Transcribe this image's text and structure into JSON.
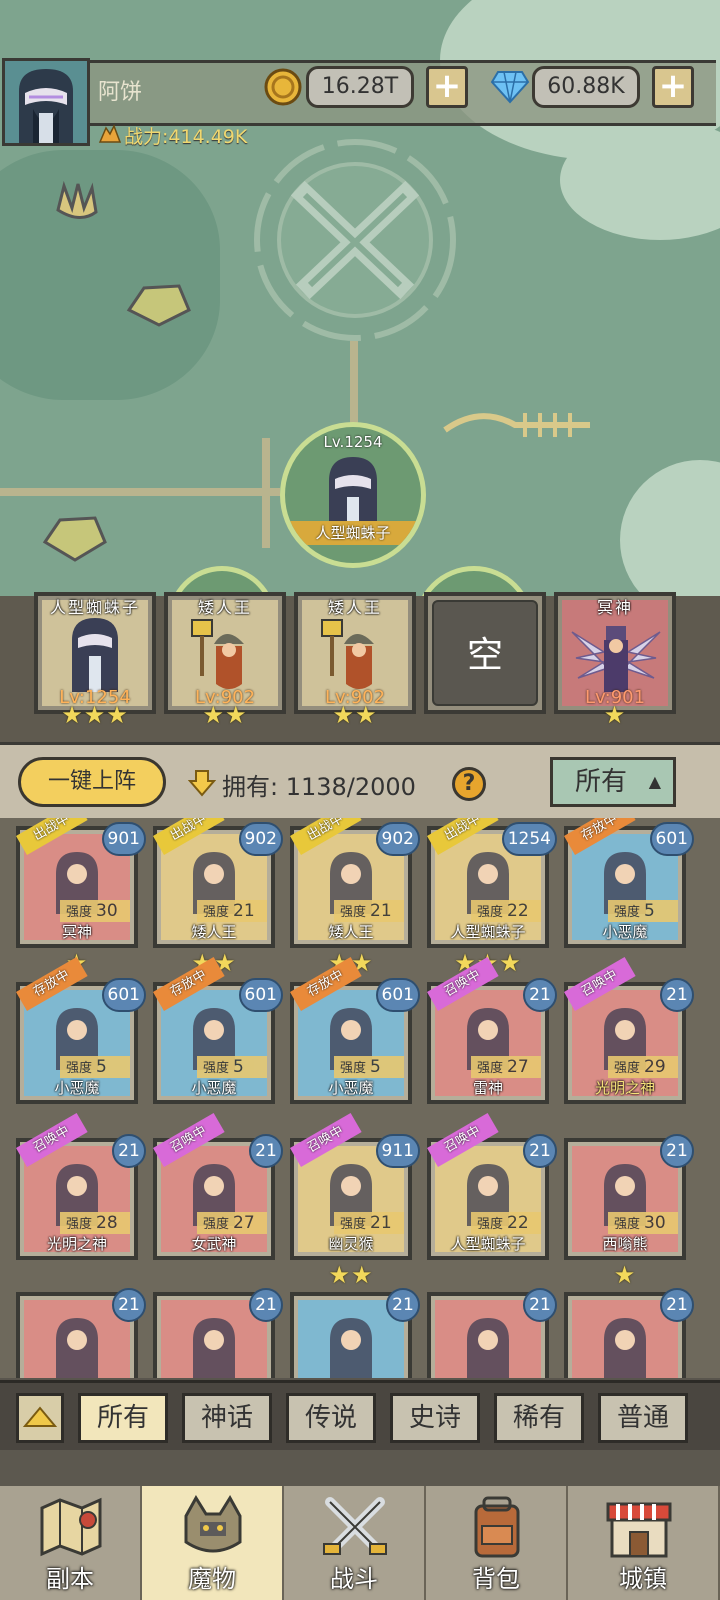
{
  "header": {
    "player_name": "阿饼",
    "power": "战力:414.49K",
    "gold": "16.28T",
    "gems": "60.88K",
    "plus": "+"
  },
  "bubble": {
    "level": "Lv.1254",
    "name": "人型蜘蛛子"
  },
  "team": [
    {
      "name": "人型蜘蛛子",
      "level": "Lv:1254",
      "stars": "★★★",
      "color": "#cfc29a"
    },
    {
      "name": "矮人王",
      "level": "Lv:902",
      "stars": "★★",
      "color": "#cfc29a"
    },
    {
      "name": "矮人王",
      "level": "Lv:902",
      "stars": "★★",
      "color": "#cfc29a"
    },
    {
      "empty": true,
      "label": "空"
    },
    {
      "name": "冥神",
      "level": "Lv:901",
      "stars": "★",
      "color": "#c77a7a"
    }
  ],
  "toolbar": {
    "auto_deploy": "一键上阵",
    "owned_label": "拥有: 1138/2000",
    "help": "?",
    "filter": "所有"
  },
  "roster": [
    {
      "name": "冥神",
      "badge": "901",
      "tag": "出战中",
      "tag_color": "#e8c83a",
      "power_label": "强度",
      "power": "30",
      "stars": "★",
      "bg": "#d98d86"
    },
    {
      "name": "矮人王",
      "badge": "902",
      "tag": "出战中",
      "tag_color": "#e8c83a",
      "power_label": "强度",
      "power": "21",
      "stars": "★★",
      "bg": "#e0c98a"
    },
    {
      "name": "矮人王",
      "badge": "902",
      "tag": "出战中",
      "tag_color": "#e8c83a",
      "power_label": "强度",
      "power": "21",
      "stars": "★★",
      "bg": "#e0c98a"
    },
    {
      "name": "人型蜘蛛子",
      "badge": "1254",
      "tag": "出战中",
      "tag_color": "#e8c83a",
      "power_label": "强度",
      "power": "22",
      "stars": "★★★",
      "bg": "#e0c98a"
    },
    {
      "name": "小恶魔",
      "badge": "601",
      "tag": "存放中",
      "tag_color": "#e98a3a",
      "power_label": "强度",
      "power": "5",
      "stars": "",
      "bg": "#7fb8d0"
    },
    {
      "name": "小恶魔",
      "badge": "601",
      "tag": "存放中",
      "tag_color": "#e98a3a",
      "power_label": "强度",
      "power": "5",
      "stars": "",
      "bg": "#7fb8d0"
    },
    {
      "name": "小恶魔",
      "badge": "601",
      "tag": "存放中",
      "tag_color": "#e98a3a",
      "power_label": "强度",
      "power": "5",
      "stars": "",
      "bg": "#7fb8d0"
    },
    {
      "name": "小恶魔",
      "badge": "601",
      "tag": "存放中",
      "tag_color": "#e98a3a",
      "power_label": "强度",
      "power": "5",
      "stars": "",
      "bg": "#7fb8d0"
    },
    {
      "name": "雷神",
      "badge": "21",
      "tag": "召唤中",
      "tag_color": "#d86ad8",
      "power_label": "强度",
      "power": "27",
      "stars": "",
      "bg": "#d98d86"
    },
    {
      "name": "光明之神",
      "badge": "21",
      "tag": "召唤中",
      "tag_color": "#d86ad8",
      "power_label": "强度",
      "power": "29",
      "stars": "",
      "bg": "#d98d86",
      "gold_name": true
    },
    {
      "name": "光明之神",
      "badge": "21",
      "tag": "召唤中",
      "tag_color": "#d86ad8",
      "power_label": "强度",
      "power": "28",
      "stars": "",
      "bg": "#d98d86"
    },
    {
      "name": "女武神",
      "badge": "21",
      "tag": "召唤中",
      "tag_color": "#d86ad8",
      "power_label": "强度",
      "power": "27",
      "stars": "",
      "bg": "#d98d86"
    },
    {
      "name": "幽灵猴",
      "badge": "911",
      "tag": "召唤中",
      "tag_color": "#d86ad8",
      "power_label": "强度",
      "power": "21",
      "stars": "★★",
      "bg": "#e0c98a"
    },
    {
      "name": "人型蜘蛛子",
      "badge": "21",
      "tag": "召唤中",
      "tag_color": "#d86ad8",
      "power_label": "强度",
      "power": "22",
      "stars": "",
      "bg": "#e0c98a"
    },
    {
      "name": "西嗡熊",
      "badge": "21",
      "tag": "",
      "tag_color": "",
      "power_label": "强度",
      "power": "30",
      "stars": "★",
      "bg": "#d98d86"
    },
    {
      "name": "",
      "badge": "21",
      "tag": "",
      "tag_color": "",
      "power_label": "",
      "power": "",
      "stars": "",
      "bg": "#d98d86"
    },
    {
      "name": "",
      "badge": "21",
      "tag": "",
      "tag_color": "",
      "power_label": "",
      "power": "",
      "stars": "",
      "bg": "#d98d86"
    },
    {
      "name": "",
      "badge": "21",
      "tag": "",
      "tag_color": "",
      "power_label": "",
      "power": "",
      "stars": "",
      "bg": "#7fb8d0"
    },
    {
      "name": "",
      "badge": "21",
      "tag": "",
      "tag_color": "",
      "power_label": "",
      "power": "",
      "stars": "",
      "bg": "#d98d86"
    },
    {
      "name": "",
      "badge": "21",
      "tag": "",
      "tag_color": "",
      "power_label": "",
      "power": "",
      "stars": "",
      "bg": "#d98d86"
    }
  ],
  "rarity_filters": [
    {
      "label": "所有",
      "active": true
    },
    {
      "label": "神话"
    },
    {
      "label": "传说"
    },
    {
      "label": "史诗"
    },
    {
      "label": "稀有"
    },
    {
      "label": "普通"
    }
  ],
  "nav": [
    {
      "label": "副本",
      "icon": "map-icon"
    },
    {
      "label": "魔物",
      "icon": "monster-icon",
      "active": true
    },
    {
      "label": "战斗",
      "icon": "swords-icon"
    },
    {
      "label": "背包",
      "icon": "backpack-icon"
    },
    {
      "label": "城镇",
      "icon": "town-icon"
    }
  ]
}
